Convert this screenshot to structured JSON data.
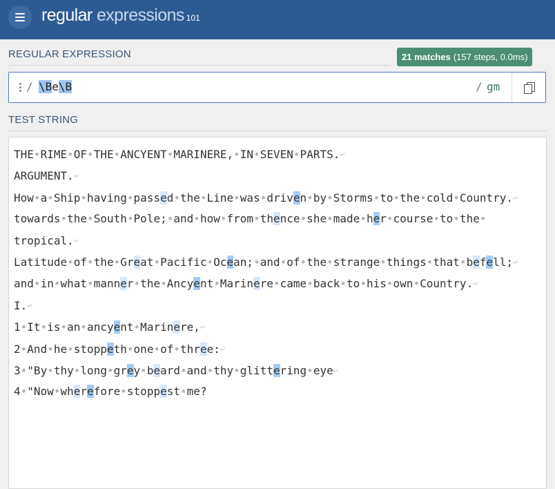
{
  "header": {
    "brand_main": "regular",
    "brand_light": " expressions",
    "brand_version": "101"
  },
  "regex_section": {
    "title": "REGULAR EXPRESSION",
    "match_count": "21 matches",
    "match_detail": "(157 steps, 0.0ms)",
    "open_delimiter": "/",
    "pattern_tokens": [
      "\\B",
      "e",
      "\\B"
    ],
    "close_delimiter": "/",
    "flags": "gm",
    "copy_icon": "copy-icon"
  },
  "test_section": {
    "title": "TEST STRING",
    "lines": [
      "THE RIME OF THE ANCYENT MARINERE, IN SEVEN PARTS.",
      "ARGUMENT.",
      "How a Ship having passed the Line was driven by Storms to the cold Country.",
      "towards the South Pole; and how from thence she made her course to the tropical.",
      "Latitude of the Great Pacific Ocean; and of the strange things that befell;",
      "and in what manner the Ancyent Marinere came back to his own Country.",
      "I.",
      "1 It is an ancyent Marinere,",
      "2 And he stoppeth one of three:",
      "3 \"By thy long grey beard and thy glittering eye",
      "4 \"Now wherefore stoppest me?"
    ]
  },
  "colors": {
    "header_bg": "#2c5b94",
    "badge_bg": "#4b8e72",
    "match_light": "#d6e7fb",
    "match_dark": "#a5cbf3",
    "token_highlight": "#9fc3ef"
  }
}
